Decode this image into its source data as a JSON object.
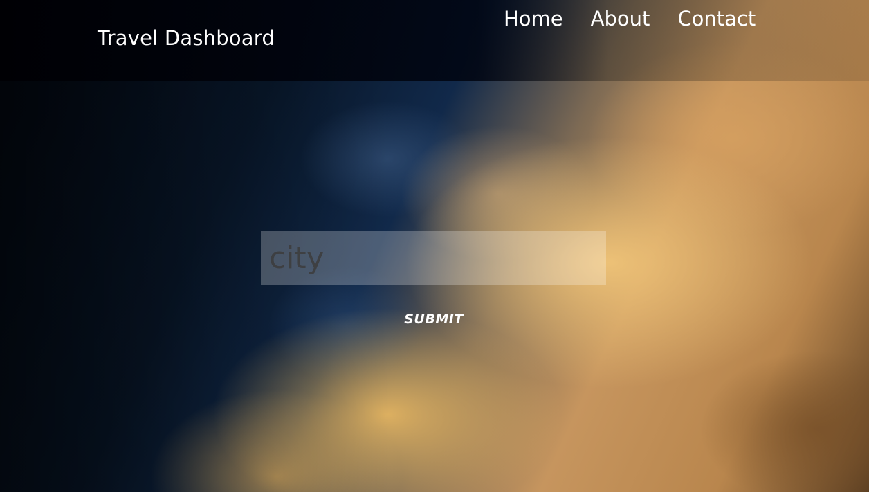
{
  "navbar": {
    "brand": "Travel Dashboard",
    "links": [
      {
        "label": "Home"
      },
      {
        "label": "About"
      },
      {
        "label": "Contact"
      }
    ]
  },
  "search": {
    "placeholder": "city",
    "value": ""
  },
  "submit": {
    "label": "SUBMIT"
  },
  "colors": {
    "text": "#ffffff",
    "navbar_bg": "#000004",
    "cloud_gold": "#e6b46a",
    "sky_dark": "#081628"
  }
}
